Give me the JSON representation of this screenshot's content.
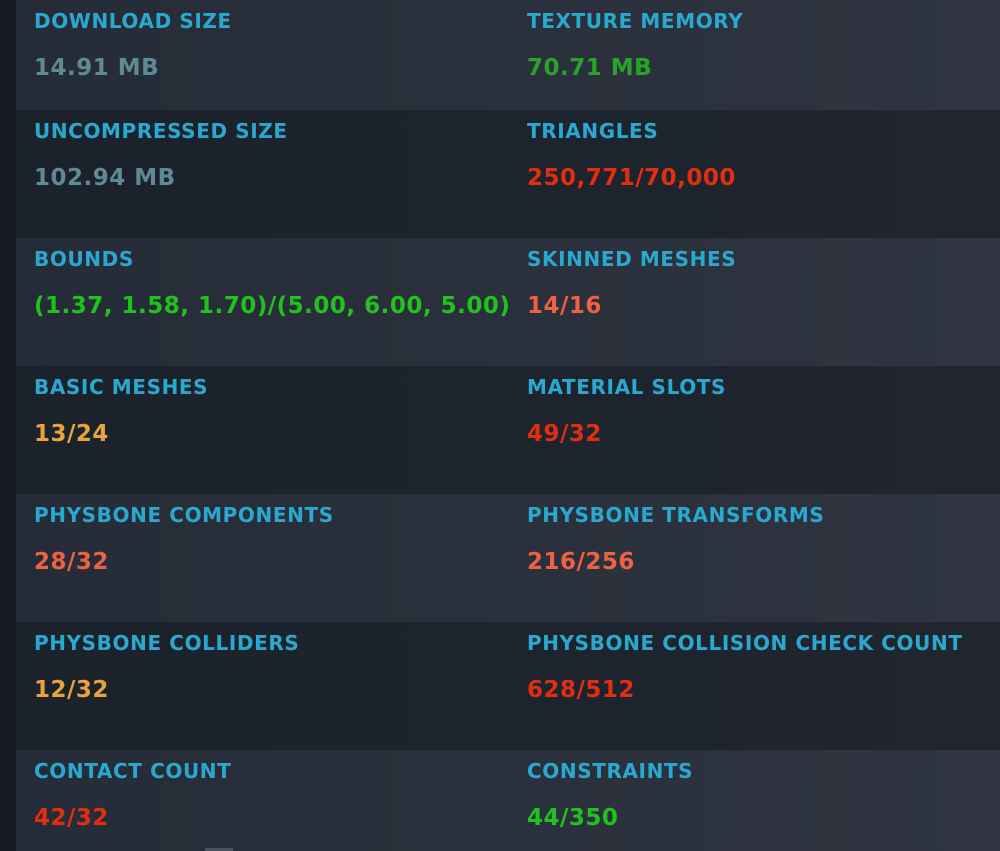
{
  "colors": {
    "label": "#2aa9d0",
    "neutral": "#5e8a96",
    "good": "#22c21e",
    "dark_good": "#2aa32a",
    "warn": "#e8a33a",
    "medium": "#ee6143",
    "poor": "#e22e10"
  },
  "stats": [
    {
      "left": {
        "label": "DOWNLOAD SIZE",
        "value": "14.91 MB",
        "color": "#5e8a96"
      },
      "right": {
        "label": "TEXTURE MEMORY",
        "value": "70.71 MB",
        "color": "#2aa32a"
      }
    },
    {
      "left": {
        "label": "UNCOMPRESSED SIZE",
        "value": "102.94 MB",
        "color": "#5e8a96"
      },
      "right": {
        "label": "TRIANGLES",
        "value": "250,771/70,000",
        "color": "#e22e10"
      }
    },
    {
      "left": {
        "label": "BOUNDS",
        "value": "(1.37, 1.58, 1.70)/(5.00, 6.00, 5.00)",
        "color": "#22c21e"
      },
      "right": {
        "label": "SKINNED MESHES",
        "value": "14/16",
        "color": "#ee6143"
      }
    },
    {
      "left": {
        "label": "BASIC MESHES",
        "value": "13/24",
        "color": "#e8a33a"
      },
      "right": {
        "label": "MATERIAL SLOTS",
        "value": "49/32",
        "color": "#e22e10"
      }
    },
    {
      "left": {
        "label": "PHYSBONE COMPONENTS",
        "value": "28/32",
        "color": "#ee6143"
      },
      "right": {
        "label": "PHYSBONE TRANSFORMS",
        "value": "216/256",
        "color": "#ee6143"
      }
    },
    {
      "left": {
        "label": "PHYSBONE COLLIDERS",
        "value": "12/32",
        "color": "#e8a33a"
      },
      "right": {
        "label": "PHYSBONE COLLISION CHECK COUNT",
        "value": "628/512",
        "color": "#e22e10"
      }
    },
    {
      "left": {
        "label": "CONTACT COUNT",
        "value": "42/32",
        "color": "#e22e10"
      },
      "right": {
        "label": "CONSTRAINTS",
        "value": "44/350",
        "color": "#22c21e"
      }
    }
  ]
}
